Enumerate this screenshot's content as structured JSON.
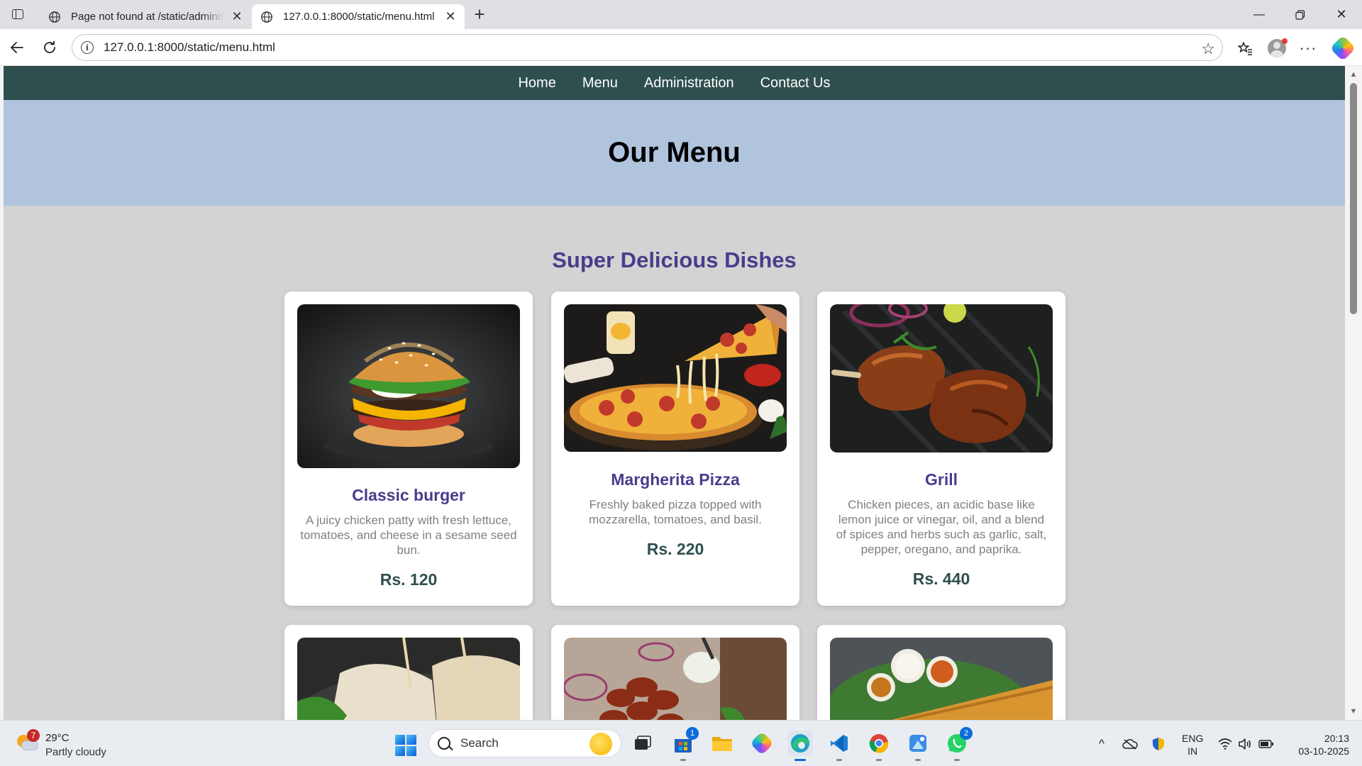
{
  "browser": {
    "tabs": [
      {
        "title": "Page not found at /static/administration.html"
      },
      {
        "title": "127.0.0.1:8000/static/menu.html"
      }
    ],
    "url": "127.0.0.1:8000/static/menu.html"
  },
  "site": {
    "nav": [
      "Home",
      "Menu",
      "Administration",
      "Contact Us"
    ],
    "hero_title": "Our Menu",
    "section_title": "Super Delicious Dishes",
    "dishes": [
      {
        "name": "Classic burger",
        "desc": "A juicy chicken patty with fresh lettuce, tomatoes, and cheese in a sesame seed bun.",
        "price": "Rs. 120",
        "image": "burger-photo"
      },
      {
        "name": "Margherita Pizza",
        "desc": "Freshly baked pizza topped with mozzarella, tomatoes, and basil.",
        "price": "Rs. 220",
        "image": "pizza-photo"
      },
      {
        "name": "Grill",
        "desc": "Chicken pieces, an acidic base like lemon juice or vinegar, oil, and a blend of spices and herbs such as garlic, salt, pepper, oregano, and paprika.",
        "price": "Rs. 440",
        "image": "grilled-chicken-photo"
      },
      {
        "image": "wrap-photo"
      },
      {
        "image": "kebab-photo"
      },
      {
        "image": "dosa-photo"
      }
    ],
    "colors": {
      "nav_bg": "#2f4f4f",
      "hero_bg": "#b0c4de",
      "page_bg": "#d3d3d3",
      "accent": "#483d8b"
    }
  },
  "taskbar": {
    "weather": {
      "temp": "29°C",
      "condition": "Partly cloudy",
      "badge": "7"
    },
    "search_placeholder": "Search",
    "store_badge": "1",
    "whatsapp_badge": "2",
    "lang": {
      "line1": "ENG",
      "line2": "IN"
    },
    "time": "20:13",
    "date": "03-10-2025"
  }
}
